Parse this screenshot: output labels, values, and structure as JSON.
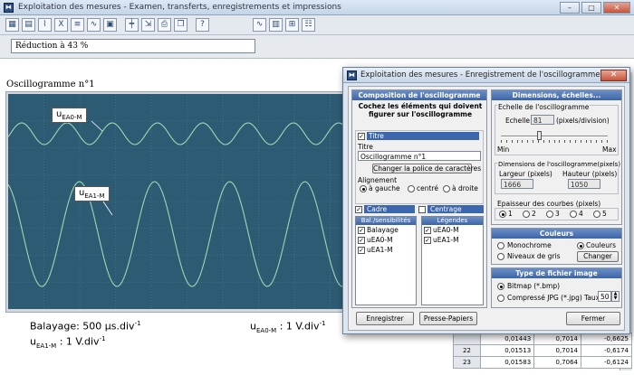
{
  "window": {
    "title": "Exploitation des mesures - Examen, transferts, enregistrements et impressions"
  },
  "status": {
    "zoom": "Réduction à 43 %"
  },
  "oscillogram": {
    "title": "Oscillogramme n°1",
    "curve0_main": "u",
    "curve0_sub": "EA0-M",
    "curve1_main": "u",
    "curve1_sub": "EA1-M",
    "sweep_label": "Balayage: 500 µs.div",
    "sweep_exp": "-1",
    "sens0_main": "u",
    "sens0_sub": "EA0-M",
    "sens0_value": " :  1 V.div",
    "sens0_exp": "-1",
    "sens1_main": "u",
    "sens1_sub": "EA1-M",
    "sens1_value": " :  1 V.div",
    "sens1_exp": "-1",
    "curve_color": "#9fd6b0",
    "screen_color": "#2e5b74"
  },
  "table": {
    "rows": [
      {
        "idx": "",
        "a": "0,01443",
        "b": "0,7014",
        "c": "-0,6625"
      },
      {
        "idx": "22",
        "a": "0,01513",
        "b": "0,7014",
        "c": "-0,6174"
      },
      {
        "idx": "23",
        "a": "0,01583",
        "b": "0,7064",
        "c": "-0,6124"
      }
    ]
  },
  "dialog": {
    "title": "Exploitation des mesures - Enregistrement de l'oscillogramme",
    "composition": {
      "header": "Composition de l'oscillogramme",
      "instruction": "Cochez les éléments qui doivent figurer sur l'oscillogramme",
      "titre_check": "Titre",
      "titre_label": "Titre",
      "titre_value": "Oscillogramme n°1",
      "font_button": "Changer la police de caractères",
      "align_label": "Alignement",
      "align_left": "à gauche",
      "align_center": "centré",
      "align_right": "à droite",
      "cadre": "Cadre",
      "centrage": "Centrage",
      "bal_header": "Bal./sensibilités",
      "bal_items": [
        "Balayage",
        "uEA0-M",
        "uEA1-M"
      ],
      "leg_header": "Légendes",
      "leg_items": [
        "uEA0-M",
        "uEA1-M"
      ]
    },
    "dimensions": {
      "header": "Dimensions, échelles...",
      "scale_group": "Echelle de l'oscillogramme",
      "scale_label": "Echelle",
      "scale_value": "81",
      "scale_unit": "(pixels/division)",
      "min": "Min",
      "max": "Max",
      "slider_level": 0.35,
      "dim_group": "Dimensions de l'oscillogramme(pixels)",
      "width_label": "Largeur (pixels)",
      "height_label": "Hauteur (pixels)",
      "width_value": "1666",
      "height_value": "1050",
      "thick_group": "Epaisseur des courbes (pixels)",
      "thick_options": [
        "1",
        "2",
        "3",
        "4",
        "5"
      ],
      "thick_selected": 0
    },
    "colors": {
      "header": "Couleurs",
      "mono": "Monochrome",
      "couleurs": "Couleurs",
      "gris": "Niveaux de gris",
      "change": "Changer"
    },
    "filetype": {
      "header": "Type de fichier image",
      "bitmap": "Bitmap (*.bmp)",
      "jpg": "Compressé JPG (*.jpg)",
      "taux_label": "Taux",
      "taux_value": "50"
    },
    "buttons": {
      "save": "Enregistrer",
      "clipboard": "Presse-Papiers",
      "close": "Fermer"
    }
  }
}
